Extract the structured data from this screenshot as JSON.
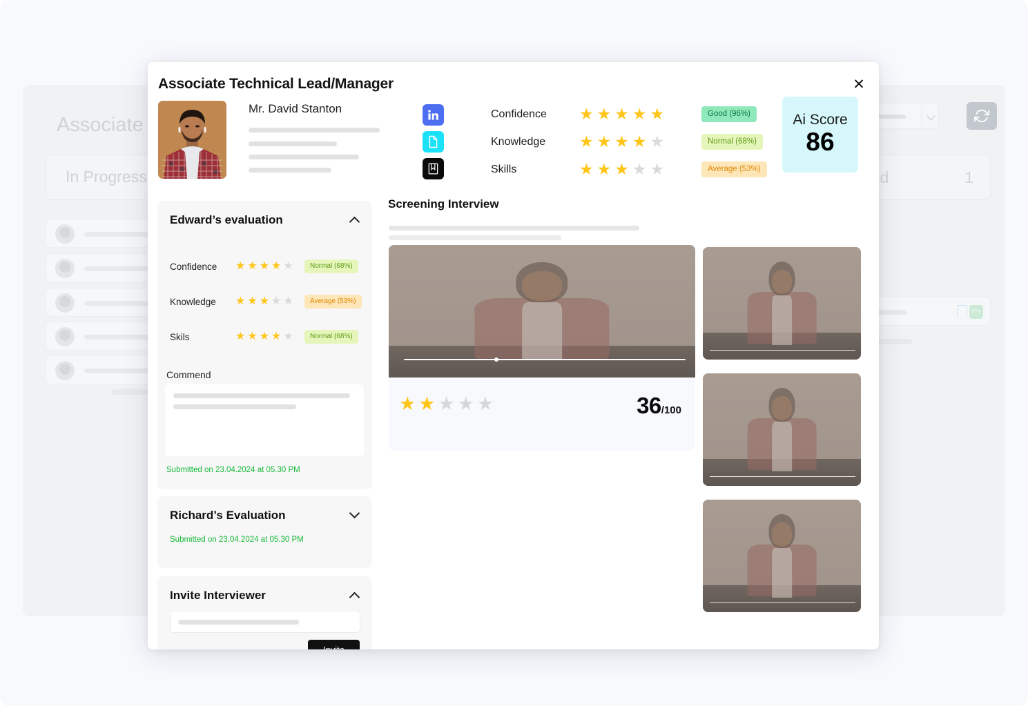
{
  "background": {
    "page_title": "Associate Soft",
    "columns": [
      {
        "label": "In Progress",
        "count": ""
      },
      {
        "label": "red",
        "count": "1"
      }
    ],
    "badge_pct": "96%",
    "refresh_icon": "refresh-icon",
    "dropdown_chevron_icon": "chevron-down-icon"
  },
  "modal": {
    "title": "Associate Technical Lead/Manager",
    "close_label": "✕",
    "candidate": {
      "name": "Mr. David Stanton",
      "photo_alt": "candidate-photo"
    },
    "social_icons": [
      {
        "name": "linkedin-icon",
        "glyph": "in"
      },
      {
        "name": "document-icon",
        "glyph": "doc"
      },
      {
        "name": "bookmark-icon",
        "glyph": "bm"
      }
    ],
    "ai_ratings": [
      {
        "label": "Confidence",
        "stars": 5,
        "max": 5,
        "badge": "Good (96%)",
        "badge_class": "good"
      },
      {
        "label": "Knowledge",
        "stars": 4,
        "max": 5,
        "badge": "Normal (68%)",
        "badge_class": "normal"
      },
      {
        "label": "Skills",
        "stars": 3,
        "max": 5,
        "badge": "Average (53%)",
        "badge_class": "average"
      }
    ],
    "ai_score": {
      "label": "Ai Score",
      "value": "86"
    },
    "evaluations": [
      {
        "title": "Edward’s evaluation",
        "expanded": true,
        "chevron_icon": "chevron-up-icon",
        "rows": [
          {
            "label": "Confidence",
            "stars": 4,
            "max": 5,
            "badge": "Normal (68%)",
            "badge_class": "normal"
          },
          {
            "label": "Knowledge",
            "stars": 3,
            "max": 5,
            "badge": "Average (53%)",
            "badge_class": "average"
          },
          {
            "label": "Skils",
            "stars": 4,
            "max": 5,
            "badge": "Normal (68%)",
            "badge_class": "normal"
          }
        ],
        "commend_label": "Commend",
        "submitted": "Submitted on 23.04.2024 at 05.30 PM"
      },
      {
        "title": "Richard’s Evaluation",
        "expanded": false,
        "chevron_icon": "chevron-down-icon",
        "submitted": "Submitted on 23.04.2024 at 05.30 PM"
      }
    ],
    "invite": {
      "title": "Invite Interviewer",
      "chevron_icon": "chevron-up-icon",
      "input_placeholder": "",
      "button_label": "Invite"
    },
    "screening": {
      "title": "Screening Interview",
      "video_stars": 2,
      "video_stars_max": 5,
      "score": "36",
      "score_denominator": "/100",
      "progress_percent": 32,
      "thumbnails": [
        "interview-thumbnail-1",
        "interview-thumbnail-2",
        "interview-thumbnail-3"
      ]
    }
  },
  "colors": {
    "accent_good": "#8fe9bd",
    "accent_normal": "#e6f6bb",
    "accent_average": "#fde6b8",
    "ai_score_bg": "#d6f7fb",
    "star": "#ffc61a",
    "submitted_text": "#18b939",
    "page_bg": "#f8f9fd"
  }
}
